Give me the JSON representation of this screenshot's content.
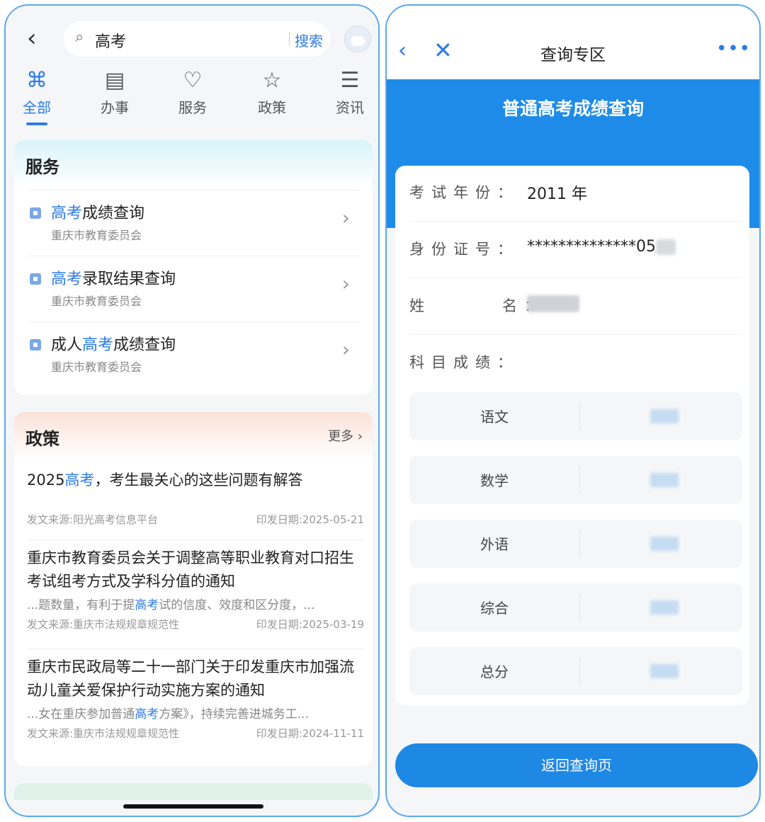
{
  "left": {
    "search": {
      "query": "高考",
      "button": "搜索"
    },
    "tabs": [
      {
        "label": "全部",
        "icon": "grid-icon",
        "active": true
      },
      {
        "label": "办事",
        "icon": "document-clock-icon"
      },
      {
        "label": "服务",
        "icon": "heart-icon"
      },
      {
        "label": "政策",
        "icon": "badge-star-icon"
      },
      {
        "label": "资讯",
        "icon": "news-icon"
      }
    ],
    "services": {
      "title": "服务",
      "items": [
        {
          "pre": "",
          "hl": "高考",
          "post": "成绩查询",
          "org": "重庆市教育委员会"
        },
        {
          "pre": "",
          "hl": "高考",
          "post": "录取结果查询",
          "org": "重庆市教育委员会"
        },
        {
          "pre": "成人",
          "hl": "高考",
          "post": "成绩查询",
          "org": "重庆市教育委员会"
        }
      ]
    },
    "policy": {
      "title": "政策",
      "more": "更多",
      "items": [
        {
          "t_pre": "2025",
          "t_hl": "高考",
          "t_post": "，考生最关心的这些问题有解答",
          "source": "发文来源:阳光高考信息平台",
          "date": "印发日期:2025-05-21"
        },
        {
          "t_pre": "重庆市教育委员会关于调整高等职业教育对口招生考试组考方式及学科分值的通知",
          "t_hl": "",
          "t_post": "",
          "ex_pre": "...题数量，有利于提",
          "ex_hl": "高考",
          "ex_post": "试的信度、效度和区分度，...",
          "source": "发文来源:重庆市法规规章规范性",
          "date": "印发日期:2025-03-19"
        },
        {
          "t_pre": "重庆市民政局等二十一部门关于印发重庆市加强流动儿童关爱保护行动实施方案的通知",
          "t_hl": "",
          "t_post": "",
          "ex_pre": "...女在重庆参加普通",
          "ex_hl": "高考",
          "ex_post": "方案》，持续完善进城务工...",
          "source": "发文来源:重庆市法规规章规范性",
          "date": "印发日期:2024-11-11"
        }
      ]
    }
  },
  "right": {
    "nav_title": "查询专区",
    "banner_title": "普通高考成绩查询",
    "fields": {
      "year_label": "考试年份：",
      "year_value": "2011 年",
      "id_label": "身份证号：",
      "id_value": "**************05",
      "name_label": "姓      名：",
      "scores_label": "科目成绩："
    },
    "subjects": [
      "语文",
      "数学",
      "外语",
      "综合",
      "总分"
    ],
    "back_button": "返回查询页"
  },
  "colors": {
    "accent": "#2d7be5",
    "banner": "#1e8be8",
    "frame": "#5aa8ec"
  }
}
